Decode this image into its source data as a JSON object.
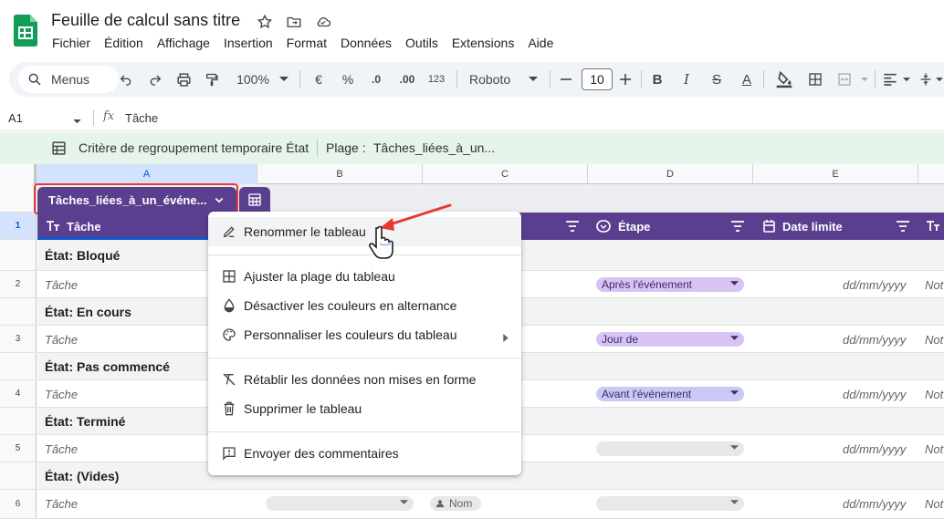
{
  "app": {
    "title": "Feuille de calcul sans titre",
    "brand_color": "#0f9d58"
  },
  "menubar": [
    "Fichier",
    "Édition",
    "Affichage",
    "Insertion",
    "Format",
    "Données",
    "Outils",
    "Extensions",
    "Aide"
  ],
  "toolbar": {
    "search_label": "Menus",
    "zoom": "100%",
    "currency": "€",
    "percent": "%",
    "dec_decrease": ".0",
    "dec_increase": ".00",
    "number_format": "123",
    "font": "Roboto",
    "font_size": "10"
  },
  "formula_bar": {
    "cell_ref": "A1",
    "fx": "fx",
    "value": "Tâche"
  },
  "grouping_bar": {
    "criterion": "Critère de regroupement temporaire État",
    "range_label": "Plage :",
    "range_value": "Tâches_liées_à_un..."
  },
  "columns": [
    "A",
    "B",
    "C",
    "D",
    "E"
  ],
  "rows": [
    "1",
    "2",
    "3",
    "4",
    "5",
    "6"
  ],
  "table": {
    "name": "Tâches_liées_à_un_événe...",
    "color": "#5b3f8f",
    "headers": {
      "tache": "Tâche",
      "etape": "Étape",
      "date_limite": "Date limite"
    },
    "groups": [
      {
        "label": "État: Bloqué",
        "task": "Tâche",
        "stage": "Après l'événement",
        "stage_color": "#d7c4f5",
        "date": "dd/mm/yyyy",
        "note": "Not"
      },
      {
        "label": "État: En cours",
        "task": "Tâche",
        "stage": "Jour de",
        "stage_color": "#d7c4f5",
        "date": "dd/mm/yyyy",
        "note": "Not"
      },
      {
        "label": "État: Pas commencé",
        "task": "Tâche",
        "stage": "Avant l'événement",
        "stage_color": "#c8c9f5",
        "date": "dd/mm/yyyy",
        "note": "Not"
      },
      {
        "label": "État: Terminé",
        "task": "Tâche",
        "stage": "",
        "stage_color": "#e8e8e8",
        "date": "dd/mm/yyyy",
        "note": "Not"
      },
      {
        "label": "État: (Vides)",
        "task": "Tâche",
        "stage": "",
        "stage_color": "#e8e8e8",
        "date": "dd/mm/yyyy",
        "note": "Not",
        "owner": "Nom"
      }
    ]
  },
  "context_menu": {
    "rename": "Renommer le tableau",
    "adjust_range": "Ajuster la plage du tableau",
    "disable_alt_colors": "Désactiver les couleurs en alternance",
    "customize_colors": "Personnaliser les couleurs du tableau",
    "revert_data": "Rétablir les données non mises en forme",
    "delete_table": "Supprimer le tableau",
    "send_feedback": "Envoyer des commentaires"
  }
}
